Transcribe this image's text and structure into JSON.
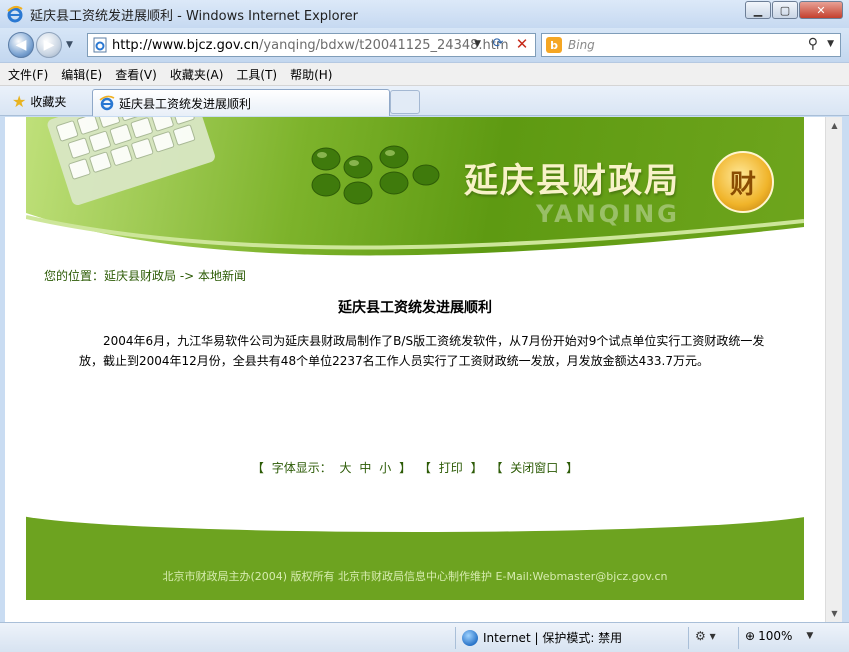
{
  "window": {
    "title": "延庆县工资统发进展顺利 - Windows Internet Explorer",
    "minimize": "▁",
    "maximize": "▢",
    "close": "✕"
  },
  "nav": {
    "url_host": "http://www.bjcz.gov.cn",
    "url_path": "/yanqing/bdxw/t20041125_24348.htm",
    "search_placeholder": "Bing"
  },
  "menu": {
    "items": [
      "文件(F)",
      "编辑(E)",
      "查看(V)",
      "收藏夹(A)",
      "工具(T)",
      "帮助(H)"
    ]
  },
  "favorites": {
    "label": "收藏夹",
    "tab_title": "延庆县工资统发进展顺利"
  },
  "page": {
    "site_name": "延庆县财政局",
    "site_pinyin": "YANQING",
    "emblem_char": "财",
    "breadcrumb": "您的位置：延庆县财政局 -> 本地新闻",
    "article_title": "延庆县工资统发进展顺利",
    "article_body": "2004年6月，九江华易软件公司为延庆县财政局制作了B/S版工资统发软件，从7月份开始对9个试点单位实行工资财政统一发放，截止到2004年12月份，全县共有48个单位2237名工作人员实行了工资财政统一发放，月发放金额达433.7万元。",
    "tools": {
      "bracket_open": "【",
      "bracket_close": "】",
      "font_label": "字体显示：",
      "font_large": "大",
      "font_medium": "中",
      "font_small": "小",
      "print": "打印",
      "close_window": "关闭窗口"
    },
    "footer": "北京市财政局主办(2004) 版权所有 北京市财政局信息中心制作维护 E-Mail:Webmaster@bjcz.gov.cn"
  },
  "status": {
    "zone": "Internet | 保护模式: 禁用",
    "zoom": "100%"
  }
}
